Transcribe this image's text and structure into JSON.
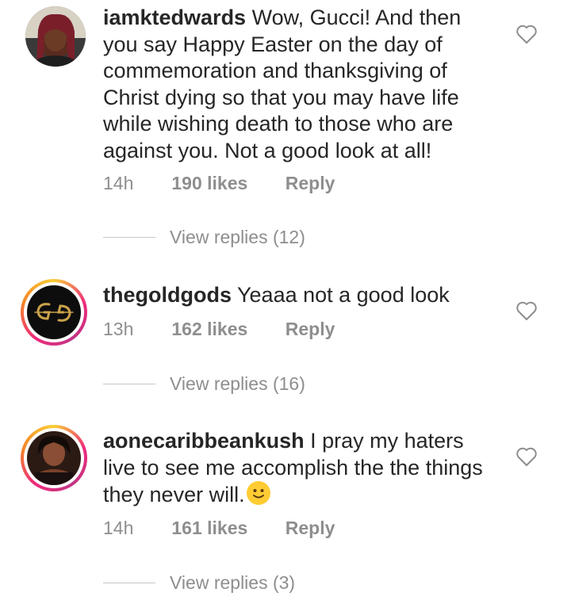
{
  "comments": [
    {
      "username": "iamktedwards",
      "text": "Wow, Gucci! And then you say Happy Easter on the day of commemoration and thanksgiving of Christ dying so that you may have life while wishing death to those who are against you. Not a good look at all!",
      "time": "14h",
      "likes": "190 likes",
      "reply": "Reply",
      "view_replies": "View replies (12)"
    },
    {
      "username": "thegoldgods",
      "text": "Yeaaa not a good look",
      "time": "13h",
      "likes": "162 likes",
      "reply": "Reply",
      "view_replies": "View replies (16)"
    },
    {
      "username": "aonecaribbeankush",
      "text": "I pray my haters live to see me accomplish the the things they never will.",
      "emoji": "smiling-face-emoji",
      "time": "14h",
      "likes": "161 likes",
      "reply": "Reply",
      "view_replies": "View replies (3)"
    }
  ],
  "icons": {
    "like": "heart-outline-icon"
  },
  "colors": {
    "text": "#262626",
    "meta": "#8e8e8e",
    "gold": "#c9a24a"
  }
}
